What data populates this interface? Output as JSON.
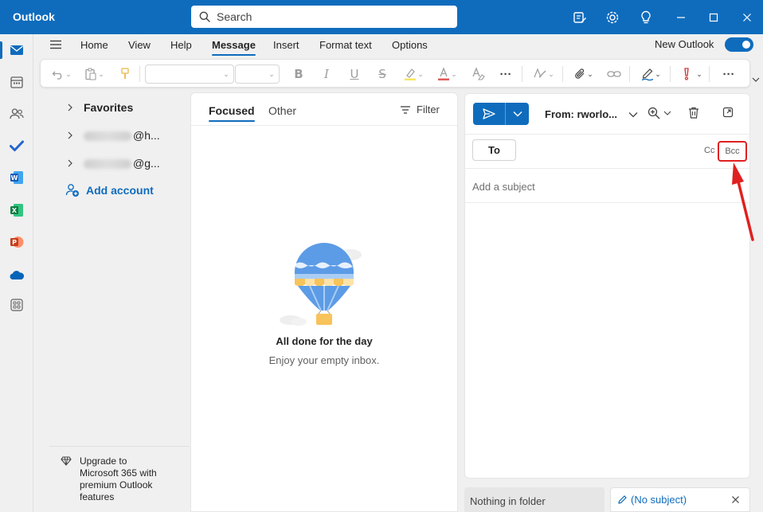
{
  "window": {
    "title": "Outlook",
    "search_placeholder": "Search"
  },
  "menu": {
    "tabs": [
      "Home",
      "View",
      "Help",
      "Message",
      "Insert",
      "Format text",
      "Options"
    ],
    "active_tab": "Message",
    "new_outlook_label": "New Outlook",
    "new_outlook_on": true
  },
  "rail": {
    "items": [
      "mail-icon",
      "calendar-icon",
      "people-icon",
      "todo-icon",
      "word-icon",
      "excel-icon",
      "powerpoint-icon",
      "onedrive-icon",
      "apps-icon"
    ]
  },
  "folders": {
    "favorites": "Favorites",
    "account1_suffix": "@h...",
    "account2_suffix": "@g...",
    "add_account": "Add account",
    "upgrade": "Upgrade to Microsoft 365 with premium Outlook features"
  },
  "message_list": {
    "tab_focused": "Focused",
    "tab_other": "Other",
    "filter": "Filter",
    "empty_title": "All done for the day",
    "empty_subtitle": "Enjoy your empty inbox."
  },
  "compose": {
    "from": "From: rworlo...",
    "to_label": "To",
    "cc_label": "Cc",
    "bcc_label": "Bcc",
    "subject_placeholder": "Add a subject"
  },
  "bottom_tabs": {
    "tab1": "Nothing in folder",
    "tab2": "(No subject)"
  },
  "colors": {
    "accent": "#0f6cbd",
    "highlight": "#e02020"
  }
}
